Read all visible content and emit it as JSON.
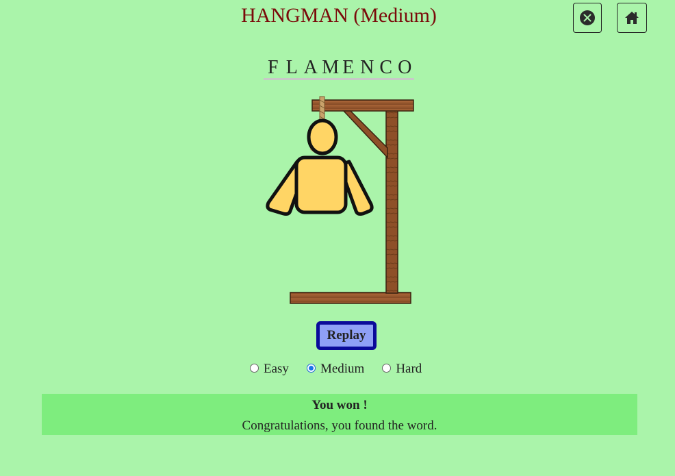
{
  "header": {
    "title": "HANGMAN (Medium)"
  },
  "toolbar": {
    "close_icon": "close-circle-icon",
    "home_icon": "home-icon"
  },
  "word": {
    "letters": [
      "F",
      "L",
      "A",
      "M",
      "E",
      "N",
      "C",
      "O"
    ]
  },
  "game": {
    "replay_label": "Replay",
    "levels": [
      {
        "label": "Easy",
        "checked": false
      },
      {
        "label": "Medium",
        "checked": true
      },
      {
        "label": "Hard",
        "checked": false
      }
    ]
  },
  "result": {
    "title": "You won !",
    "message": "Congratulations, you found the word."
  },
  "colors": {
    "background": "#aaf4aa",
    "title": "#7a0a0a",
    "result_bg": "#7eed7e",
    "replay_bg": "#8fa0f6",
    "replay_border": "#0a0a9a",
    "wood": "#8b4f28",
    "skin": "#ffd565"
  }
}
